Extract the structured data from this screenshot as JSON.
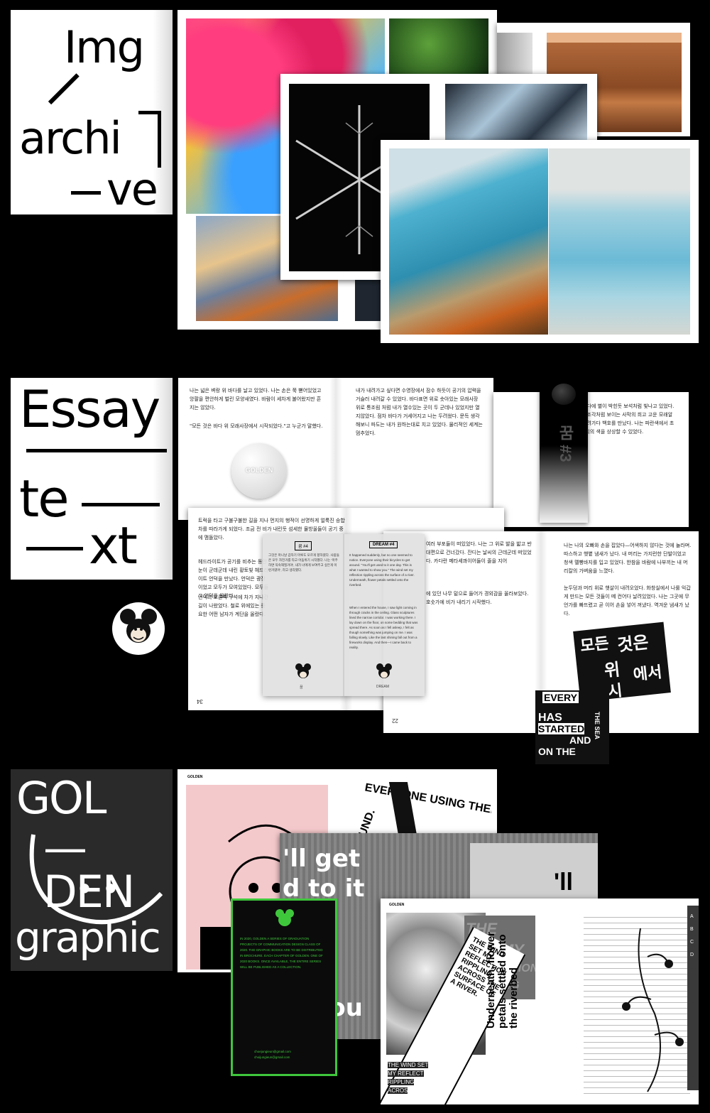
{
  "sections": {
    "img": {
      "cover_lines": [
        "Img",
        "archi",
        "ve"
      ]
    },
    "essay": {
      "cover_lines": [
        "Essay",
        "te",
        "xt"
      ],
      "badge_label": "GOLDEN",
      "page_left_text": "나는 넓은 벼랑 위 바다를 날고 있었다. 나는 손은 쭉 뻗어있었고 앙팔을 편안하게 벌린 모양새였다. 바람이 세차게 불어왔지만 흔지는 않았다.",
      "page_left_quote": "\"모든 것은 바다 위 모래사장에서 시작되었다.\"고 누군가 말했다.",
      "page_right_text": "내가 내려가고 싶다면 수영장에서 잠수 하듯이 공기의 압력을 거슬러 내려갈 수 있었다. 바다표면 위로 솟아있는 모래사장 위로 통조림 처럼 내가 열수있는 곳이 두 군데나 있었지만 열지않았다. 점차 바다가 거세어지고 나는 두려웠다. 문득 생각해보니 파도는 내가 원하는대로 치고 있었다. 물리적인 세계는 멈추었다.",
      "far_right_text": "나는 바다에 별이 박힌듯 보석처럼 빛나고 있었다. 보석은 조각처럼 보이는 사막의 희고 고운 모래알 위에 내려가다 백호를 만났다. 나는 파란색에서 초록색까지의 색을 상상할 수 있었다.",
      "bookmark_label": "꿈 #3",
      "mid_left_text": "트럭을 타고 구불구불한 길을 지나 먼지의 행적이 선명하게 얼룩진 승합차를 따라가게 되었다. 조금 전 비가 내린듯 섬세한 물방울들이 공기 중에 맴돌았다.",
      "mid_left_text2": "헤드라이트가 공기를 비추는 동안 눈이 군데군데 내린 황토빛 헤드라이트 언덕을 만났다. 언덕은 광장이었고 모두가 모여있었다. 모두들 그 언덕을 올랐다.",
      "mid_left_text3": "언덕의 오른쪽 구석에 차가 지나간 길이 나왔었다. 철로 위에있는 중요한 어떤 남자가 계단을 올랐다.",
      "insert_left_tag": "꿈 #4",
      "insert_right_tag": "DREAM #4",
      "insert_left_text": "그것은 마니날 갑자기 마루도 모르게 향하였다. 사람들은 모두 자전거를 타고 어둠위기 시작했다. 나는 '마주 하면 익숙해질거야', 내가 너에게 보여주고 싶은게 이런거였어', 라고 생각했다.",
      "insert_right_text": "It happened suddenly, but no one seemed to notice. Everyone using their bicycles to get around. \"You'll get used to it one day. This is what I wanted to show you.\" The wind set my reflection rippling across the surface of a river. Underneath, flower petals settled onto the riverbed.",
      "insert_right_text2": "When I entered the house, I saw light coming in through cracks in the ceiling. Glass sculptures lined the narrow corridor. I was working there. I lay down on the floor, on some bedding that was spread there. As soon as I fell asleep, I felt as though something was jumping on me. I was falling slowly. Like the last shining fall out from a fireworks display. And then—I came back to reality.",
      "insert_left_caption": "꿈",
      "insert_right_caption": "DREAM",
      "page_bottom_right_text": "여러 부포들이 떠있었다. 나는 그 위로 발을 밟고 반대편으로 건너갔다. 잔디는 날씨의 근데군데 떠있었다. 카다란 메타세콰이어들이 줄을 지어",
      "page_bottom_right_text2": "에 있던 나무 밑으로 들어가 경외감을 올라보았다. 호숫가에 비가 내리기 시작했다.",
      "page_far_right_text": "나는 나의 오빠와 손을 잡았다—어색하지 않다는 것에 놀라며. 따스하고 햇볕 냄새가 났다. 내 머리는 가지런한 단발이었고 청색 멜빵바지를 입고 있었다. 한참을 바람에 나부끼는 내 머리칼의 가벼움을 느꼈다.",
      "page_far_right_text2": "눈두덩과 머리 위로 햇살이 내려오었다. 화창실에서 나룰 익갑게 만드는 모든 것들이 떼 컨어다 날려있었다. 나는 그곳에 무언가를 빠뜨렸고 곧 이어 손을 넣어 꺼냈다. 역겨운 냄새가 났다.",
      "page_num_left": "34",
      "page_num_right": "22",
      "sticker_text_lines": [
        "EVERY",
        "HAS",
        "STARTED",
        "AND",
        "ON THE"
      ],
      "sticker_side_text": "THE SEA",
      "collage_korean": [
        "모든",
        "것은",
        "위",
        "에서",
        "시"
      ]
    },
    "golden": {
      "cover_lines": [
        "GOL",
        "—DEN",
        "graphic"
      ],
      "smile_eyes": "• •",
      "poster_header": "GOLDEN",
      "poster_text_top": "EVERYONE USING THEIR BICY",
      "poster_round": "ROUND.",
      "poster_big": [
        "'ll get",
        "d to it",
        "o",
        "s i",
        "nt",
        "w you"
      ],
      "poster_big_right": "'ll ge",
      "wind_phrase": "THE WIND SET MY REFLECTION RIPPLING ACROSS THE SURFACE OF A RIVER.",
      "wind_gray": [
        "THE WIND",
        "SET MY",
        "REFLECTION",
        "RIPPLING"
      ],
      "wind_bottom": [
        "THE WIND SET",
        "MY REFLECT",
        "RIPPLING",
        "ACROS"
      ],
      "underneath": "Underneath, flower petals settled onto the riverbed",
      "green_block": "IN 2020, GOLDEN A SERIES OF GRADUATION PROJECTS OF COMMUNICATION DESIGN CLASS OF 2020. THE GRAPHIC BOOKS ARE TO BE DISTRIBUTED IN BROCHURE. EACH CHAPTER OF GOLDEN. ONE OF 2020 BOOKS. ONCE AVAILABLE, THE ENTIRE SERIES WILL BE PUBLISHED AS A COLLECTION.",
      "green_contact": [
        "choejungieun@gmail.com",
        "choijungieun@gmail.com"
      ],
      "tab_letters": [
        "A",
        "B",
        "C",
        "D"
      ]
    }
  }
}
